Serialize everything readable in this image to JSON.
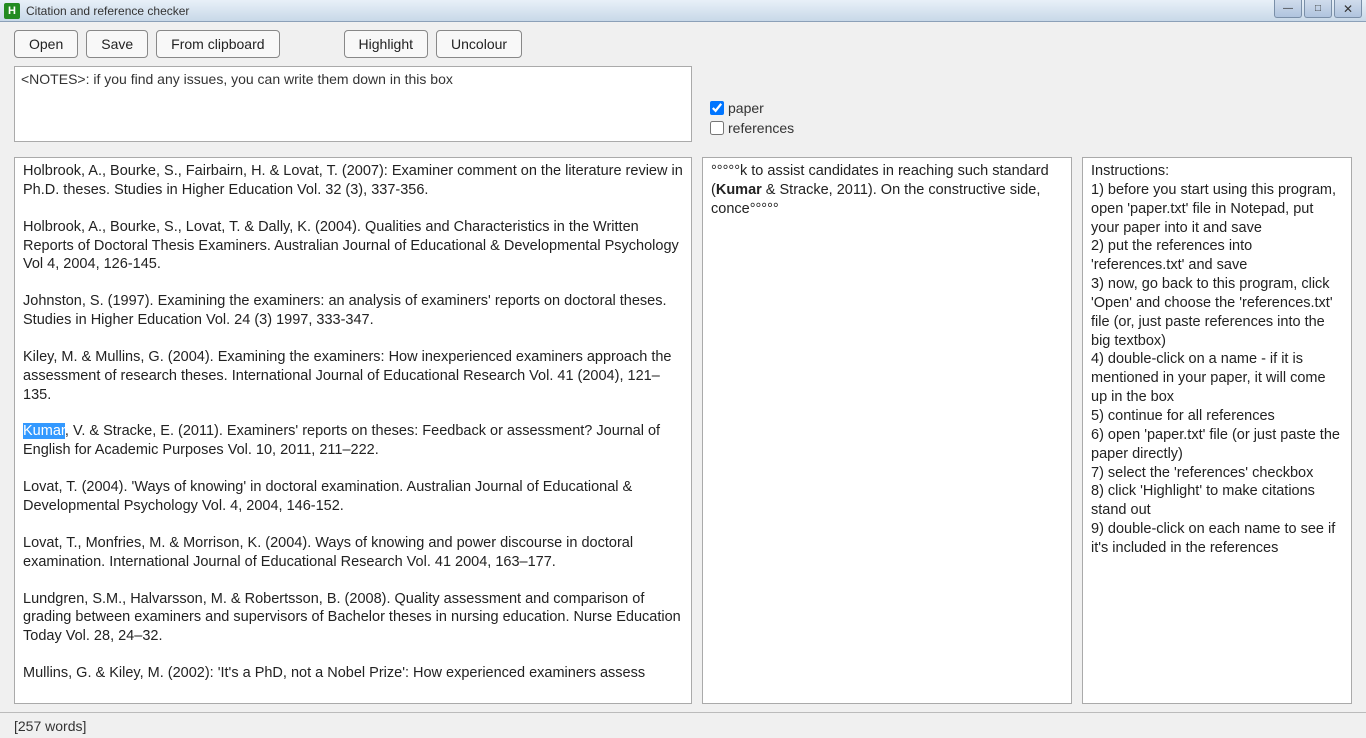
{
  "window": {
    "icon_letter": "H",
    "title": "Citation and reference checker"
  },
  "toolbar": {
    "open": "Open",
    "save": "Save",
    "from_clipboard": "From clipboard",
    "highlight": "Highlight",
    "uncolour": "Uncolour"
  },
  "notes": {
    "text": "<NOTES>: if you find any issues, you can write them down in this box"
  },
  "checks": {
    "paper_label": "paper",
    "paper_checked": true,
    "refs_label": "references",
    "refs_checked": false
  },
  "references": [
    "Holbrook, A., Bourke, S., Fairbairn, H. & Lovat, T. (2007): Examiner comment on the literature review in Ph.D. theses. Studies in Higher Education Vol. 32 (3), 337-356.",
    "Holbrook, A., Bourke, S., Lovat, T. & Dally, K. (2004). Qualities and Characteristics in the Written Reports of Doctoral Thesis Examiners. Australian Journal of Educational & Developmental Psychology Vol 4, 2004, 126-145.",
    "Johnston, S. (1997). Examining the examiners: an analysis of examiners' reports on doctoral theses. Studies in Higher Education Vol. 24 (3) 1997, 333-347.",
    "Kiley, M. & Mullins, G. (2004). Examining the examiners: How inexperienced examiners approach the assessment of research theses. International Journal of Educational Research Vol. 41 (2004), 121–135.",
    {
      "pre": "",
      "hl": "Kumar",
      "post": ", V. & Stracke, E. (2011). Examiners' reports on theses: Feedback or assessment? Journal of English for Academic Purposes Vol. 10, 2011, 211–222."
    },
    "Lovat, T. (2004). 'Ways of knowing' in doctoral examination. Australian Journal of Educational & Developmental Psychology Vol. 4, 2004, 146-152.",
    "Lovat, T., Monfries, M. & Morrison, K. (2004). Ways of knowing and power discourse in doctoral examination. International Journal of Educational Research Vol. 41 2004, 163–177.",
    "Lundgren, S.M., Halvarsson, M. & Robertsson, B. (2008). Quality assessment and comparison of grading between examiners and supervisors of Bachelor theses in nursing education. Nurse Education Today Vol. 28, 24–32.",
    "Mullins, G. & Kiley, M. (2002): 'It's a PhD, not a Nobel Prize': How experienced examiners assess"
  ],
  "context": {
    "lead": "°°°°°k to assist candidates in reaching such standard (",
    "bold": "Kumar",
    "tail": " & Stracke, 2011). On the constructive side, conce°°°°°"
  },
  "instructions": {
    "heading": "Instructions:",
    "lines": [
      "1) before you start using this program, open 'paper.txt' file in Notepad, put your paper into it and save",
      "2) put the references into 'references.txt' and save",
      "3) now, go back to this program, click 'Open' and choose the 'references.txt' file (or, just paste references into the big textbox)",
      "4) double-click on a name - if it is mentioned in your paper, it will come up in the box",
      "5) continue for all references",
      "6) open 'paper.txt' file (or just paste the paper directly)",
      "7) select the 'references' checkbox",
      "8) click 'Highlight' to make citations stand out",
      "9) double-click on each name to see if it's included in the references"
    ]
  },
  "status": {
    "words": "[257 words]"
  }
}
